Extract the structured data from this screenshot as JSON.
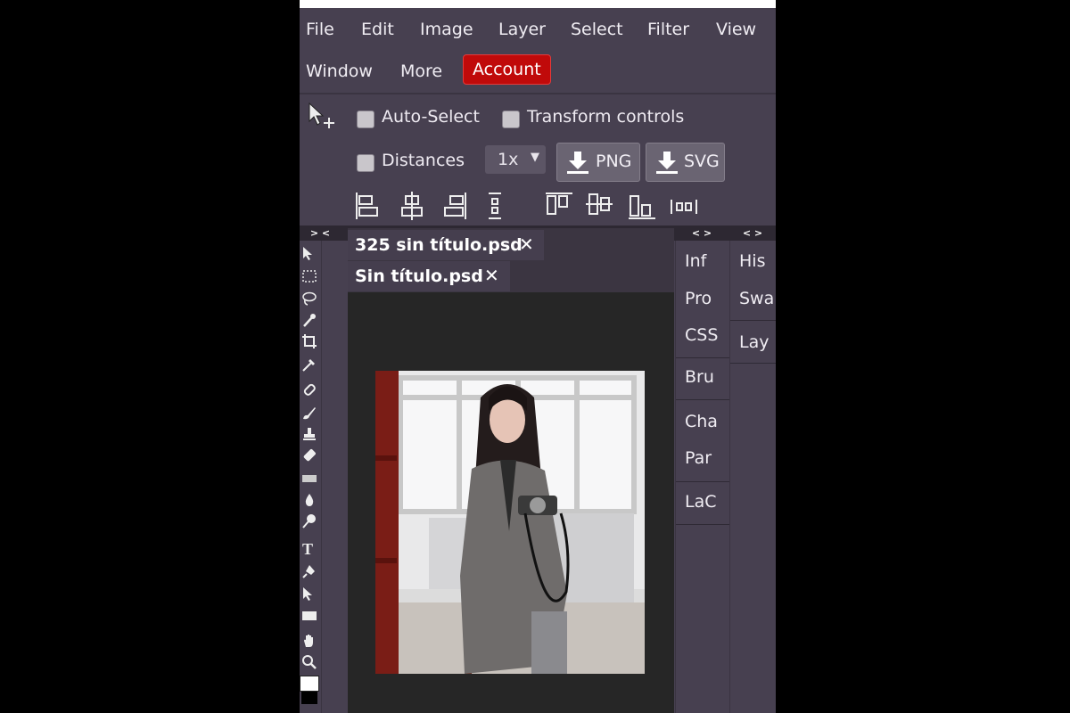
{
  "menu": {
    "items": [
      "File",
      "Edit",
      "Image",
      "Layer",
      "Select",
      "Filter",
      "View",
      "Window",
      "More"
    ],
    "account": "Account"
  },
  "options": {
    "auto_select": "Auto-Select",
    "transform_controls": "Transform controls",
    "distances": "Distances",
    "scale": "1x",
    "png_button": "PNG",
    "svg_button": "SVG"
  },
  "panels": {
    "left_toggle": "> <",
    "mid_toggle": "< >",
    "right_toggle": "< >",
    "mid_items": [
      "Inf",
      "Pro",
      "CSS",
      "Bru",
      "Cha",
      "Par",
      "LaC"
    ],
    "right_items": [
      "His",
      "Swa",
      "Lay"
    ]
  },
  "tabs": [
    {
      "title": "325 sin título.psd",
      "close": "✕"
    },
    {
      "title": "Sin título.psd",
      "close": "✕"
    }
  ],
  "colors": {
    "accent": "#c00a0a",
    "app_bg": "#474050",
    "canvas_bg": "#262626"
  },
  "icons": {
    "move_tool": "move-arrow-icon",
    "download": "download-icon"
  }
}
